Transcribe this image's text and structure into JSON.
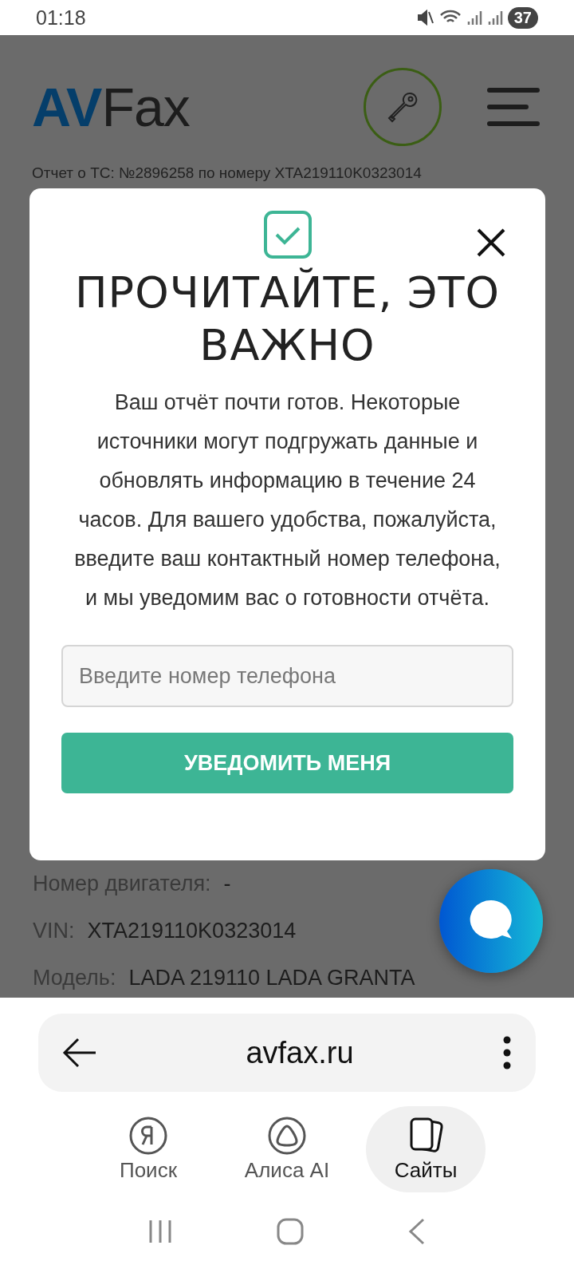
{
  "status_bar": {
    "time": "01:18",
    "battery": "37"
  },
  "site": {
    "logo_accent": "AV",
    "logo_rest": "Fax",
    "report_title": "Отчет о ТС: №2896258 по номеру XTA219110K0323014",
    "details": [
      {
        "label": "Номер двигателя:",
        "value": "-"
      },
      {
        "label": "VIN:",
        "value": "XTA219110K0323014"
      },
      {
        "label": "Модель:",
        "value": "LADA 219110 LADA GRANTA"
      }
    ]
  },
  "modal": {
    "title": "ПРОЧИТАЙТЕ, ЭТО ВАЖНО",
    "message": "Ваш отчёт почти готов. Некоторые источники могут подгружать данные и обновлять информацию в течение 24 часов. Для вашего удобства, пожалуйста, введите ваш контактный номер телефона, и мы уведомим вас о готовности отчёта.",
    "phone": {
      "placeholder": "Введите номер телефона"
    },
    "button": "УВЕДОМИТЬ МЕНЯ"
  },
  "browser": {
    "address": "avfax.ru",
    "nav": [
      {
        "label": "Поиск",
        "kind": "search",
        "selected": false
      },
      {
        "label": "Алиса AI",
        "kind": "assistant",
        "selected": false
      },
      {
        "label": "Сайты",
        "kind": "tabs",
        "selected": true
      }
    ]
  }
}
